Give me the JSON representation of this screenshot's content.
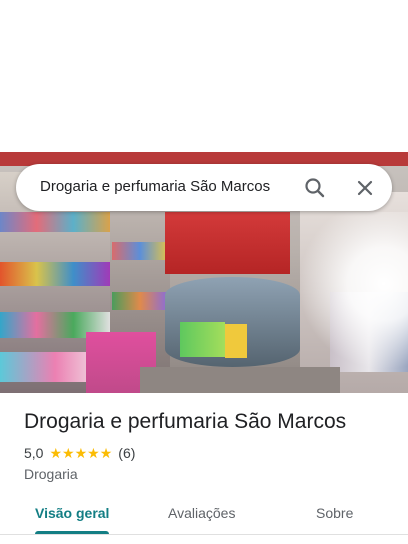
{
  "search": {
    "query": "Drogaria e perfumaria São Marcos",
    "search_icon": "search-icon",
    "close_icon": "close-icon"
  },
  "place": {
    "title": "Drogaria e perfumaria São Marcos",
    "rating": "5,0",
    "rating_value": 5.0,
    "stars_max": 5,
    "reviews": "(6)",
    "category": "Drogaria"
  },
  "tabs": [
    {
      "label": "Visão geral",
      "active": true
    },
    {
      "label": "Avaliações",
      "active": false
    },
    {
      "label": "Sobre",
      "active": false
    }
  ],
  "colors": {
    "accent": "#137e84",
    "star": "#fbbc04"
  }
}
